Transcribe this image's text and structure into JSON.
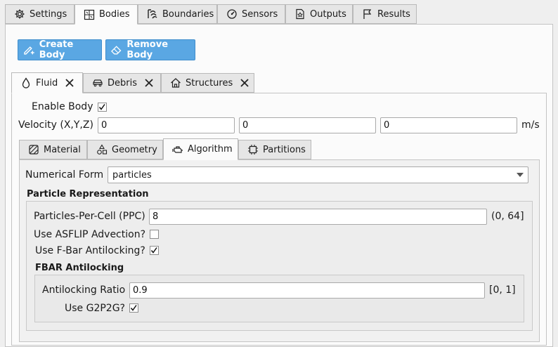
{
  "main_tabs": [
    {
      "label": "Settings",
      "icon": "gear-icon"
    },
    {
      "label": "Bodies",
      "icon": "bodies-icon"
    },
    {
      "label": "Boundaries",
      "icon": "wave-icon"
    },
    {
      "label": "Sensors",
      "icon": "gauge-icon"
    },
    {
      "label": "Outputs",
      "icon": "file-icon"
    },
    {
      "label": "Results",
      "icon": "flag-icon"
    }
  ],
  "toolbar": {
    "create_label": "Create Body",
    "remove_label": "Remove Body"
  },
  "body_tabs": [
    {
      "label": "Fluid",
      "icon": "droplet-icon"
    },
    {
      "label": "Debris",
      "icon": "car-icon"
    },
    {
      "label": "Structures",
      "icon": "house-icon"
    }
  ],
  "enable_body": {
    "label": "Enable Body",
    "checked": true
  },
  "velocity": {
    "label": "Velocity (X,Y,Z)",
    "x": "0",
    "y": "0",
    "z": "0",
    "unit": "m/s"
  },
  "sub_tabs": [
    {
      "label": "Material",
      "icon": "material-icon"
    },
    {
      "label": "Geometry",
      "icon": "shapes-icon"
    },
    {
      "label": "Algorithm",
      "icon": "engine-icon"
    },
    {
      "label": "Partitions",
      "icon": "chip-icon"
    }
  ],
  "numerical_form": {
    "label": "Numerical Form",
    "value": "particles"
  },
  "particle_rep": {
    "title": "Particle Representation",
    "ppc_label": "Particles-Per-Cell (PPC)",
    "ppc_value": "8",
    "ppc_range": "(0, 64]",
    "asflip_label": "Use ASFLIP Advection?",
    "asflip_checked": false,
    "fbar_label": "Use F-Bar Antilocking?",
    "fbar_checked": true
  },
  "fbar": {
    "title": "FBAR Antilocking",
    "ratio_label": "Antilocking Ratio",
    "ratio_value": "0.9",
    "ratio_range": "[0, 1]",
    "g2p2g_label": "Use G2P2G?",
    "g2p2g_checked": true
  },
  "colors": {
    "accent": "#5aa7e3",
    "panel": "#fbfbfb",
    "background": "#efefef"
  }
}
